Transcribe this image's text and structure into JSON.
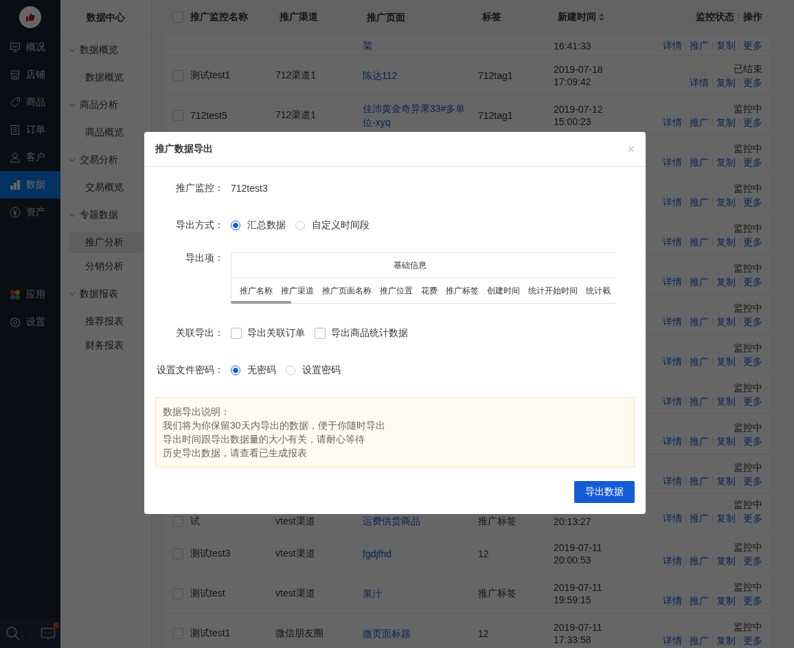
{
  "rail": {
    "items": [
      {
        "label": "概况",
        "selected": false
      },
      {
        "label": "店铺",
        "selected": false
      },
      {
        "label": "商品",
        "selected": false
      },
      {
        "label": "订单",
        "selected": false
      },
      {
        "label": "客户",
        "selected": false
      },
      {
        "label": "数据",
        "selected": true
      },
      {
        "label": "资产",
        "selected": false
      }
    ],
    "lower_items": [
      {
        "label": "应用",
        "selected": false
      },
      {
        "label": "设置",
        "selected": false
      }
    ],
    "has_unread_messages": true
  },
  "submenu": {
    "title": "数据中心",
    "groups": [
      {
        "label": "数据概览",
        "expanded": true,
        "children": [
          {
            "label": "数据概览",
            "selected": false
          }
        ]
      },
      {
        "label": "商品分析",
        "expanded": true,
        "children": [
          {
            "label": "商品概览",
            "selected": false
          }
        ]
      },
      {
        "label": "交易分析",
        "expanded": true,
        "children": [
          {
            "label": "交易概览",
            "selected": false
          }
        ]
      },
      {
        "label": "专题数据",
        "expanded": true,
        "children": [
          {
            "label": "推广分析",
            "selected": true
          },
          {
            "label": "分销分析",
            "selected": false
          }
        ]
      },
      {
        "label": "数据报表",
        "expanded": true,
        "children": [
          {
            "label": "推荐报表",
            "selected": false
          },
          {
            "label": "财务报表",
            "selected": false
          }
        ]
      }
    ]
  },
  "table": {
    "select_all_checked": false,
    "columns": [
      {
        "label": "推广监控名称",
        "sortable": false
      },
      {
        "label": "推广渠道",
        "sortable": false
      },
      {
        "label": "推广页面",
        "sortable": false
      },
      {
        "label": "标签",
        "sortable": false
      },
      {
        "label": "新建时间",
        "sortable": true
      },
      {
        "label": "监控状态",
        "sortable": false
      },
      {
        "label": "操作",
        "sortable": false
      }
    ],
    "rows": [
      {
        "partial": true,
        "page": "架",
        "time": "16:41:33",
        "actions": [
          "详情",
          "推广",
          "复制",
          "更多"
        ]
      },
      {
        "checked": false,
        "name": "测试test1",
        "channel": "712渠道1",
        "page": "陈达112",
        "tag": "712tag1",
        "date": "2019-07-18",
        "time": "17:09:42",
        "status": "已结束",
        "actions": [
          "详情",
          "复制",
          "更多"
        ]
      },
      {
        "checked": false,
        "name": "712test5",
        "channel": "712渠道1",
        "page": "佳沛黄金奇异果33#多单位-xyq",
        "tag": "712tag1",
        "date": "2019-07-12",
        "time": "15:00:23",
        "status": "监控中",
        "actions": [
          "详情",
          "推广",
          "复制",
          "更多"
        ]
      },
      {
        "status": "监控中",
        "actions": [
          "详情",
          "推广",
          "复制",
          "更多"
        ]
      },
      {
        "status": "监控中",
        "actions": [
          "详情",
          "推广",
          "复制",
          "更多"
        ]
      },
      {
        "status": "监控中",
        "actions": [
          "详情",
          "推广",
          "复制",
          "更多"
        ]
      },
      {
        "status": "监控中",
        "actions": [
          "详情",
          "推广",
          "复制",
          "更多"
        ]
      },
      {
        "status": "监控中",
        "actions": [
          "详情",
          "推广",
          "复制",
          "更多"
        ]
      },
      {
        "status": "监控中",
        "actions": [
          "详情",
          "推广",
          "复制",
          "更多"
        ]
      },
      {
        "status": "监控中",
        "actions": [
          "详情",
          "推广",
          "复制",
          "更多"
        ]
      },
      {
        "status": "监控中",
        "actions": [
          "详情",
          "推广",
          "复制",
          "更多"
        ]
      },
      {
        "status": "监控中",
        "actions": [
          "详情",
          "推广",
          "复制",
          "更多"
        ]
      },
      {
        "checked": false,
        "name": "试",
        "channel": "vtest渠道",
        "page": "运费供货商品",
        "tag": "推广标签",
        "time": "20:13:27",
        "status": "监控中",
        "actions": [
          "详情",
          "推广",
          "复制",
          "更多"
        ]
      },
      {
        "checked": false,
        "name": "测试test3",
        "channel": "vtest渠道",
        "page": "fgdjfhd",
        "tag": "12",
        "date": "2019-07-11",
        "time": "20:00:53",
        "status": "监控中",
        "actions": [
          "详情",
          "推广",
          "复制",
          "更多"
        ]
      },
      {
        "checked": false,
        "name": "测试test",
        "channel": "vtest渠道",
        "page": "果汁",
        "tag": "推广标签",
        "date": "2019-07-11",
        "time": "19:59:15",
        "status": "监控中",
        "actions": [
          "详情",
          "推广",
          "复制",
          "更多"
        ]
      },
      {
        "checked": false,
        "name": "测试test1",
        "channel": "微信朋友圈",
        "page": "微页面标题",
        "tag": "12",
        "date": "2019-07-11",
        "time": "17:33:58",
        "status": "监控中",
        "actions": [
          "详情",
          "推广",
          "复制",
          "更多"
        ]
      }
    ]
  },
  "dialog": {
    "title": "推广数据导出",
    "close": "×",
    "monitor": {
      "label": "推广监控：",
      "value": "712test3"
    },
    "export_method": {
      "label": "导出方式：",
      "options": [
        {
          "label": "汇总数据",
          "selected": true
        },
        {
          "label": "自定义时间段",
          "selected": false
        }
      ]
    },
    "export_items": {
      "label": "导出项：",
      "group": "基础信息",
      "columns": [
        "推广名称",
        "推广渠道",
        "推广页面名称",
        "推广位置",
        "花费",
        "推广标签",
        "创建时间",
        "统计开始时间",
        "统计截"
      ]
    },
    "related_export": {
      "label": "关联导出：",
      "options": [
        {
          "label": "导出关联订单",
          "checked": false
        },
        {
          "label": "导出商品统计数据",
          "checked": false
        }
      ]
    },
    "password": {
      "label": "设置文件密码：",
      "options": [
        {
          "label": "无密码",
          "selected": true
        },
        {
          "label": "设置密码",
          "selected": false
        }
      ]
    },
    "notice": [
      "数据导出说明：",
      "我们将为你保留30天内导出的数据，便于你随时导出",
      "导出时间跟导出数据量的大小有关，请耐心等待",
      "历史导出数据，请查看已生成报表"
    ],
    "submit": "导出数据"
  }
}
